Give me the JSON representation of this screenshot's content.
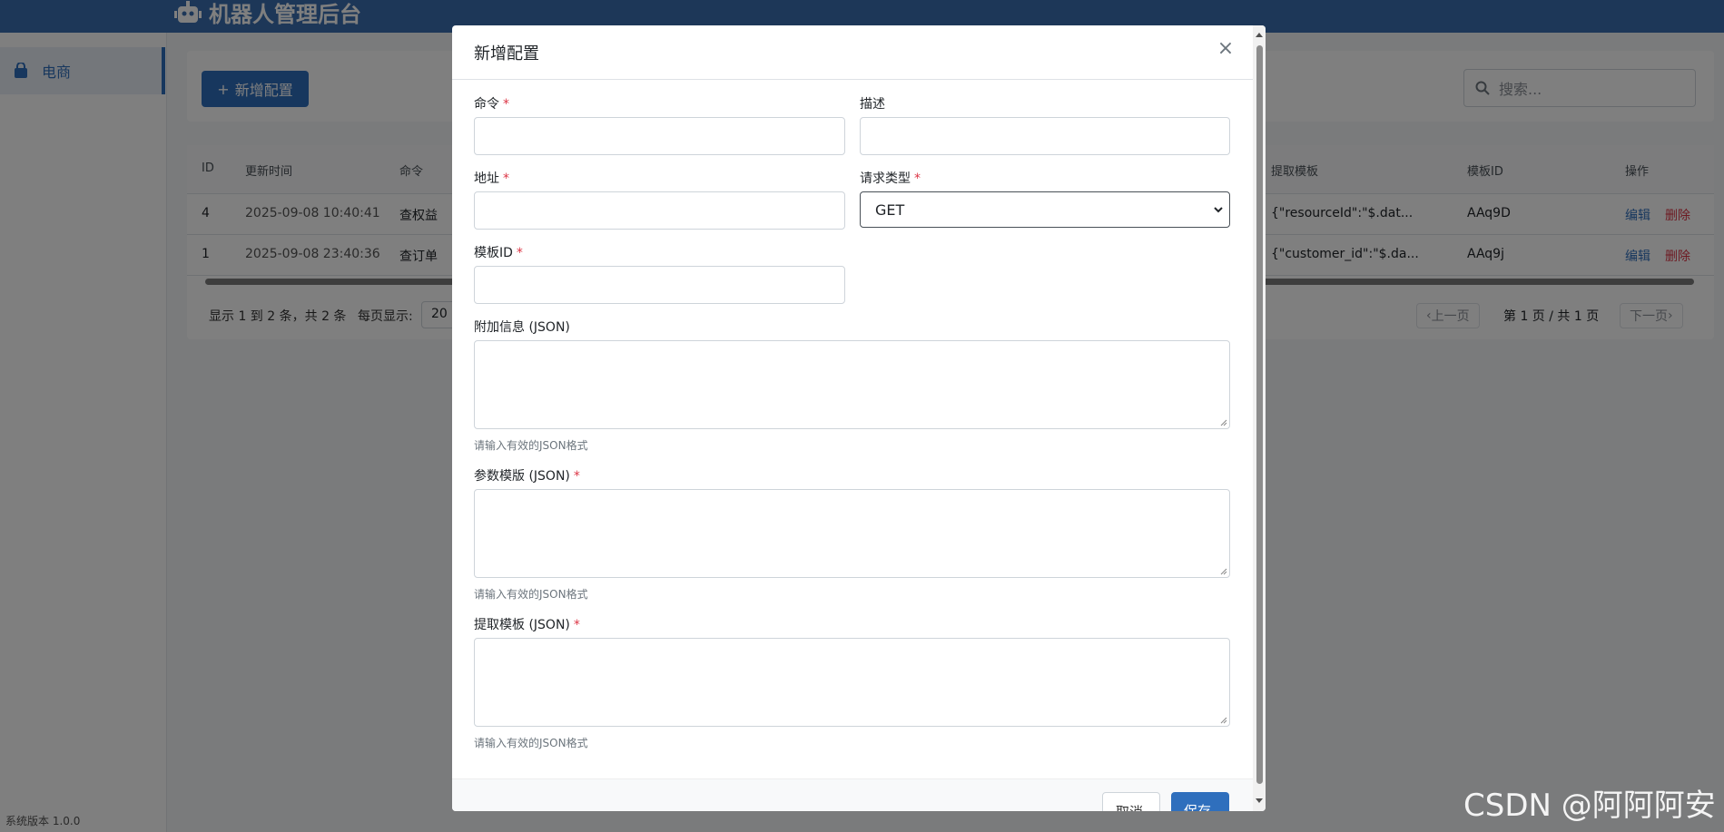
{
  "app": {
    "title": "机器人管理后台",
    "version": "系统版本 1.0.0"
  },
  "sidebar": {
    "items": [
      {
        "label": "电商",
        "icon": "shopping-bag-icon"
      }
    ]
  },
  "toolbar": {
    "add_label": "新增配置",
    "search_placeholder": "搜索..."
  },
  "table": {
    "headers": {
      "id": "ID",
      "updated": "更新时间",
      "command": "命令",
      "extract": "提取模板",
      "template_id": "模板ID",
      "actions": "操作"
    },
    "rows": [
      {
        "id": "4",
        "updated": "2025-09-08 10:40:41",
        "command": "查权益",
        "extract": "{\"resourceId\":\"$.dat...",
        "template_id": "AAq9D",
        "edit": "编辑",
        "delete": "删除"
      },
      {
        "id": "1",
        "updated": "2025-09-08 23:40:36",
        "command": "查订单",
        "extract": "{\"customer_id\":\"$.da...",
        "template_id": "AAq9j",
        "edit": "编辑",
        "delete": "删除"
      }
    ],
    "footer": {
      "summary": "显示 1 到 2 条，共 2 条",
      "per_page_label": "每页显示:",
      "per_page_value": "20",
      "prev": "上一页",
      "page_info": "第 1 页 / 共 1 页",
      "next": "下一页"
    }
  },
  "modal": {
    "title": "新增配置",
    "close": "×",
    "fields": {
      "command": {
        "label": "命令",
        "value": ""
      },
      "description": {
        "label": "描述",
        "value": ""
      },
      "address": {
        "label": "地址",
        "value": ""
      },
      "request_type": {
        "label": "请求类型",
        "value": "GET"
      },
      "template_id": {
        "label": "模板ID",
        "value": ""
      },
      "extra_info": {
        "label": "附加信息 (JSON)",
        "hint": "请输入有效的JSON格式"
      },
      "param_template": {
        "label": "参数模版 (JSON)",
        "hint": "请输入有效的JSON格式"
      },
      "extract_template": {
        "label": "提取模板 (JSON)",
        "hint": "请输入有效的JSON格式"
      }
    },
    "required_mark": "*",
    "cancel": "取消",
    "save": "保存"
  },
  "watermark": "CSDN @阿阿阿安",
  "colors": {
    "primary": "#2f6fbd",
    "danger": "#dc3545",
    "topbar": "#3b6fb0"
  }
}
